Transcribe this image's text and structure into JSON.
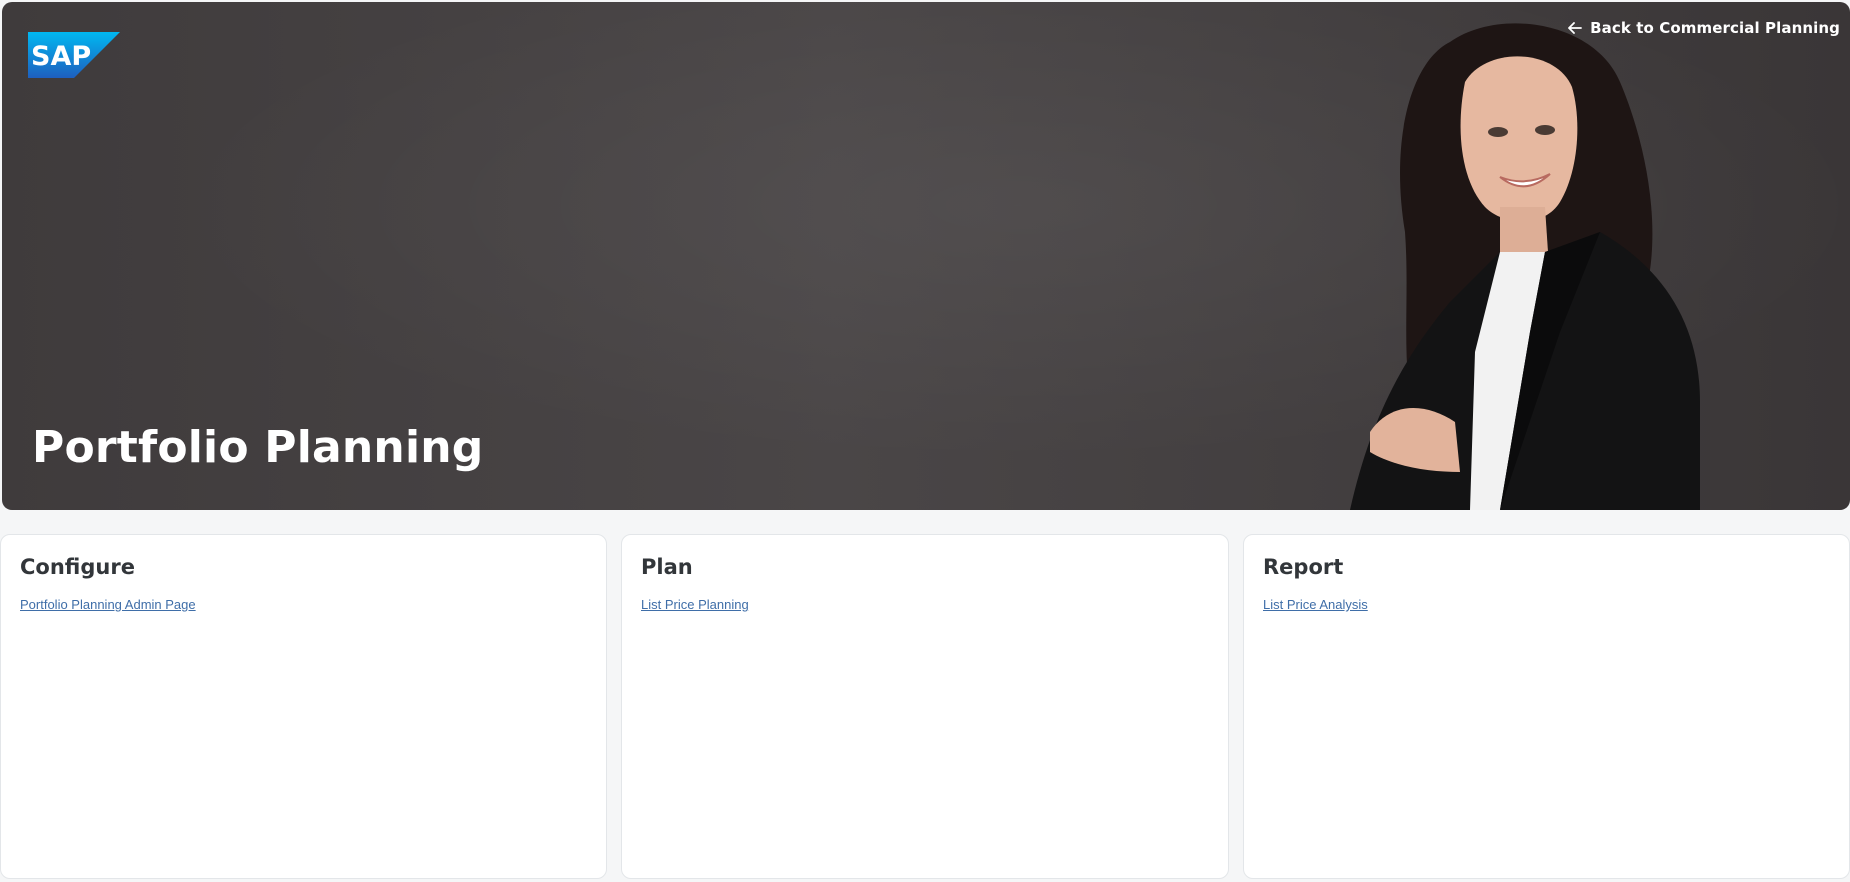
{
  "header": {
    "logo_text": "SAP",
    "back_link_label": "Back to Commercial Planning",
    "title": "Portfolio Planning"
  },
  "cards": [
    {
      "title": "Configure",
      "links": [
        "Portfolio Planning Admin Page"
      ]
    },
    {
      "title": "Plan",
      "links": [
        "List Price Planning"
      ]
    },
    {
      "title": "Report",
      "links": [
        "List Price Analysis"
      ]
    }
  ],
  "colors": {
    "hero_background": "#433f40",
    "link": "#3f6ea8",
    "card_title": "#32363a",
    "sap_blue": "#0f7fd8"
  },
  "icons": {
    "back": "arrow-left-icon"
  }
}
